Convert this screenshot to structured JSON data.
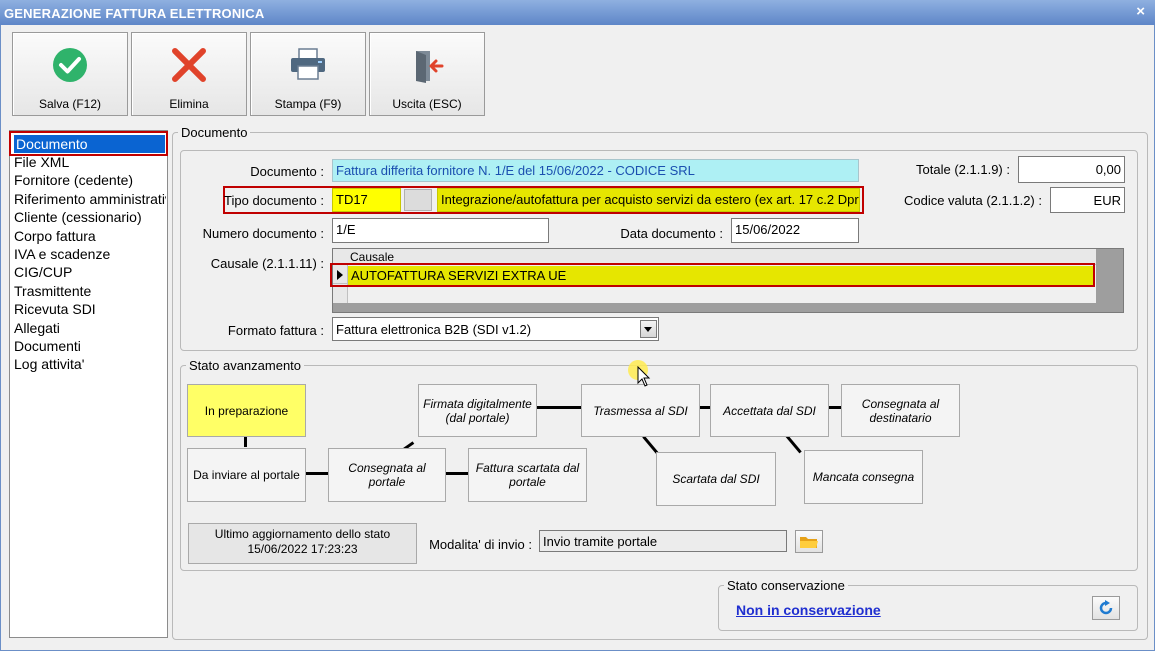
{
  "window": {
    "title": "GENERAZIONE FATTURA ELETTRONICA",
    "close": "×"
  },
  "toolbar": {
    "save": "Salva (F12)",
    "delete": "Elimina",
    "print": "Stampa (F9)",
    "exit": "Uscita (ESC)"
  },
  "sidebar": {
    "items": [
      "Documento",
      "File XML",
      "Fornitore (cedente)",
      "Riferimento amministrativo",
      "Cliente (cessionario)",
      "Corpo fattura",
      "IVA e scadenze",
      "CIG/CUP",
      "Trasmittente",
      "Ricevuta SDI",
      "Allegati",
      "Documenti",
      "Log attivita'"
    ],
    "selected": 0
  },
  "documento": {
    "group_title": "Documento",
    "documento_label": "Documento :",
    "documento_value": "Fattura differita fornitore N. 1/E del 15/06/2022 - CODICE SRL",
    "tipo_label": "Tipo documento :",
    "tipo_code": "TD17",
    "tipo_desc": "Integrazione/autofattura per acquisto servizi da estero (ex art. 17 c.2 Dpr",
    "numero_label": "Numero documento :",
    "numero_value": "1/E",
    "data_label": "Data documento :",
    "data_value": "15/06/2022",
    "causale_label": "Causale (2.1.1.11) :",
    "causale_header": "Causale",
    "causale_value": "AUTOFATTURA SERVIZI EXTRA UE",
    "formato_label": "Formato fattura :",
    "formato_value": "Fattura elettronica B2B (SDI v1.2)",
    "totale_label": "Totale (2.1.1.9) :",
    "totale_value": "0,00",
    "valuta_label": "Codice valuta (2.1.1.2) :",
    "valuta_value": "EUR"
  },
  "stato": {
    "group_title": "Stato avanzamento",
    "states": {
      "preparazione": "In preparazione",
      "da_inviare": "Da inviare al portale",
      "consegnata_portale": "Consegnata al portale",
      "firmata": "Firmata digitalmente (dal portale)",
      "scartata_portale": "Fattura scartata dal portale",
      "trasmessa": "Trasmessa al SDI",
      "scartata_sdi": "Scartata dal SDI",
      "accettata": "Accettata dal SDI",
      "mancata": "Mancata consegna",
      "consegnata_dest": "Consegnata al destinatario"
    },
    "ultimo_label": "Ultimo aggiornamento dello stato",
    "ultimo_value": "15/06/2022 17:23:23",
    "modalita_label": "Modalita' di invio :",
    "modalita_value": "Invio tramite portale"
  },
  "conservazione": {
    "group_title": "Stato conservazione",
    "link": "Non in conservazione"
  },
  "colors": {
    "titlebar": "#5e86c8",
    "highlight": "#c00000",
    "yellow": "#ffff00",
    "cyan": "#aef0f4",
    "olive": "#e6e600"
  }
}
